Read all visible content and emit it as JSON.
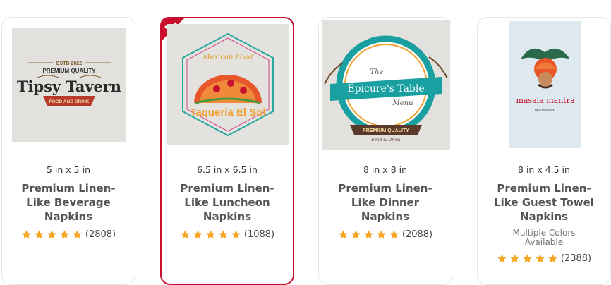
{
  "products": [
    {
      "size": "5 in x 5 in",
      "title_lines": [
        "Premium Linen-",
        "Like Beverage",
        "Napkins"
      ],
      "rating_count": "(2808)",
      "logo": {
        "top": "ESTD 2022",
        "sub": "PREMIUM QUALITY",
        "name": "Tipsy Tavern",
        "banner": "FOOD AND DRINK"
      }
    },
    {
      "size": "6.5 in x 6.5 in",
      "title_lines": [
        "Premium Linen-",
        "Like Luncheon",
        "Napkins"
      ],
      "rating_count": "(1088)",
      "selected": true,
      "logo": {
        "top": "Mexican Food",
        "name": "Taqueria El Sol"
      }
    },
    {
      "size": "8 in x 8 in",
      "title_lines": [
        "Premium Linen-",
        "Like Dinner",
        "Napkins"
      ],
      "rating_count": "(2088)",
      "logo": {
        "the": "The",
        "name": "Epicure's Table",
        "menu": "Menu",
        "banner": "PREMIUM QUALITY",
        "sub": "Food & Drink"
      }
    },
    {
      "size": "8 in x 4.5 in",
      "title_lines": [
        "Premium Linen-",
        "Like Guest Towel",
        "Napkins"
      ],
      "colors_lines": [
        "Multiple Colors",
        "Available"
      ],
      "rating_count": "(2388)",
      "logo": {
        "name": "masala mantra",
        "sub": "RESTAURANT"
      }
    }
  ],
  "colors": {
    "star": "#f5a623",
    "selected_border": "#c8102e",
    "title": "#555555"
  }
}
